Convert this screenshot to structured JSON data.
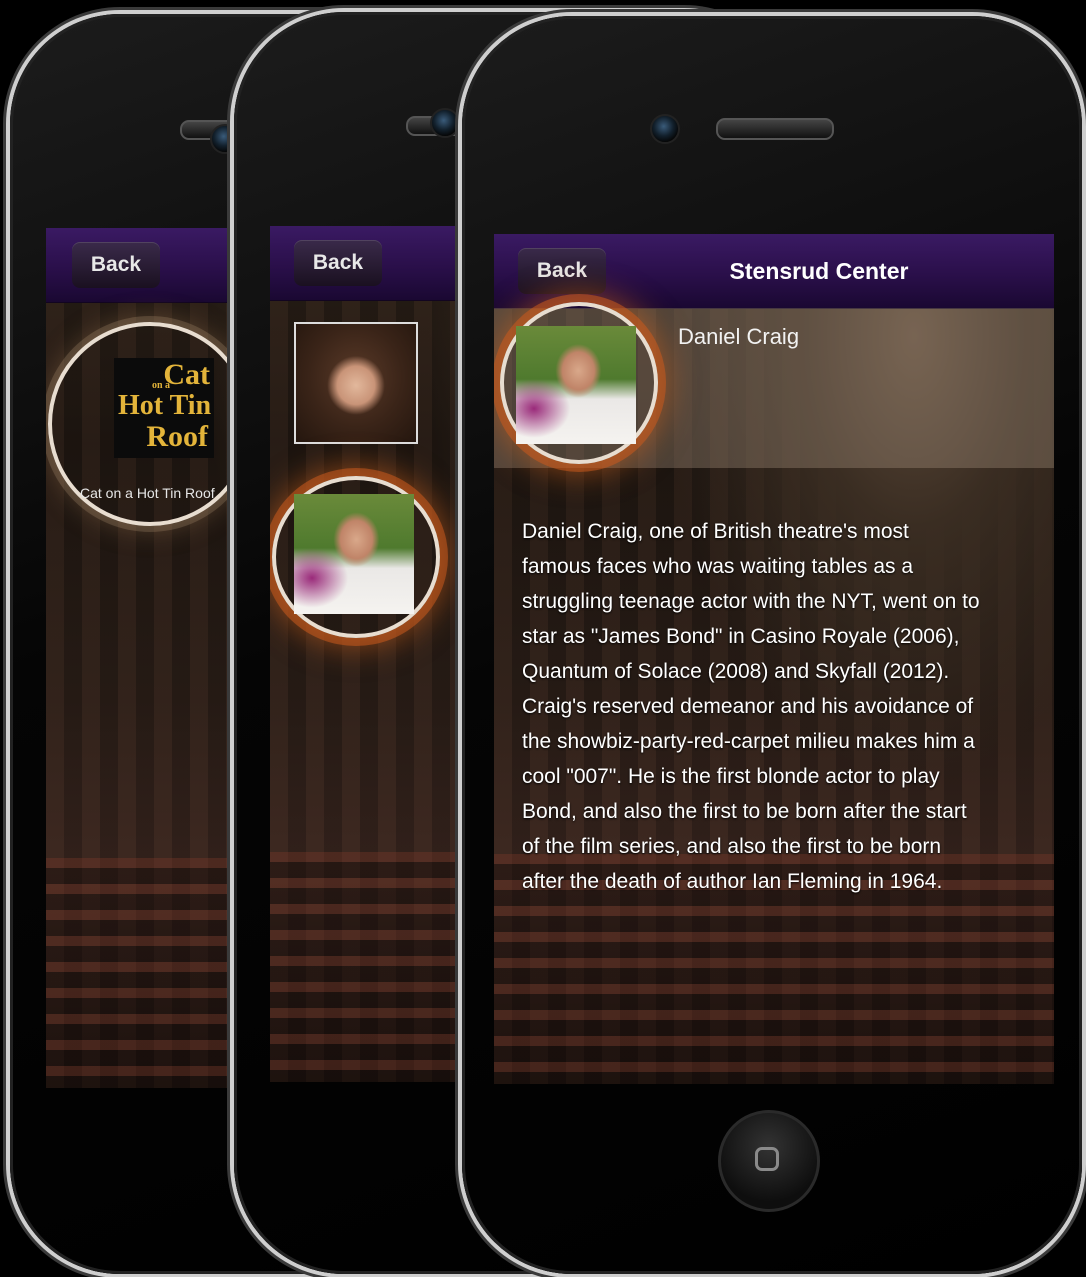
{
  "phones": {
    "back": {
      "back_label": "Back",
      "item_title": "Cat on a Hot Tin Roof",
      "logo": {
        "line1": "Cat",
        "on_a": "on a",
        "line2": "Hot Tin",
        "line3": "Roof"
      }
    },
    "middle": {
      "back_label": "Back",
      "items": [
        {
          "name": "woman-portrait",
          "selected": false
        },
        {
          "name": "daniel-craig-portrait",
          "selected": true
        }
      ]
    },
    "front": {
      "back_label": "Back",
      "title": "Stensrud Center",
      "person_name": "Daniel Craig",
      "bio_lines": [
        "Daniel Craig, one of British theatre's most",
        "famous faces who was waiting tables as a",
        "struggling teenage actor with the NYT, went on to",
        "star as \"James Bond\" in Casino Royale (2006),",
        "Quantum of Solace (2008) and Skyfall (2012).",
        "Craig's reserved demeanor and his avoidance of",
        "the showbiz-party-red-carpet milieu makes him a",
        "cool \"007\". He is the first blonde actor to play",
        "Bond, and also the first to be born after the start",
        "of the film series, and also the first to be born",
        "after the death of author Ian Fleming in 1964."
      ]
    }
  },
  "colors": {
    "navbar": "#2a0f4a",
    "glow": "#c85a1e",
    "ring": "#e8ddd0",
    "logo_text": "#e3b43a"
  }
}
